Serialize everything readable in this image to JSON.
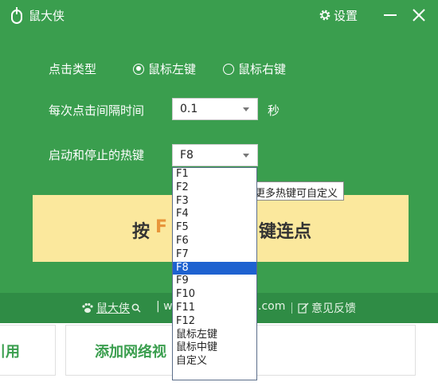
{
  "window": {
    "title": "鼠大侠",
    "settings_label": "设置"
  },
  "form": {
    "click_type_label": "点击类型",
    "click_type_options": [
      "鼠标左键",
      "鼠标右键"
    ],
    "click_type_selected": "鼠标左键",
    "interval_label": "每次点击间隔时间",
    "interval_value": "0.1",
    "interval_unit": "秒",
    "hotkey_label": "启动和停止的热键",
    "hotkey_value": "F8"
  },
  "big_button": {
    "prefix": "按",
    "key_partial": "F",
    "suffix": "键连点"
  },
  "tooltip": "更多热键可自定义",
  "dropdown": {
    "options": [
      "F1",
      "F2",
      "F3",
      "F4",
      "F5",
      "F6",
      "F7",
      "F8",
      "F9",
      "F10",
      "F11",
      "F12",
      "鼠标左键",
      "鼠标中键",
      "自定义"
    ],
    "selected": "F8"
  },
  "footer": {
    "brand": "鼠大侠",
    "url_left": "| w",
    "url_right": ".com",
    "feedback": "意见反馈"
  },
  "bottom_tabs": [
    "引用",
    "添加网络视"
  ],
  "colors": {
    "app_green": "#3a9e4e",
    "footer_green": "#2f8c45",
    "button_yellow": "#fbe89d",
    "highlight_orange": "#e8953a",
    "selection_blue": "#1e62d0"
  }
}
